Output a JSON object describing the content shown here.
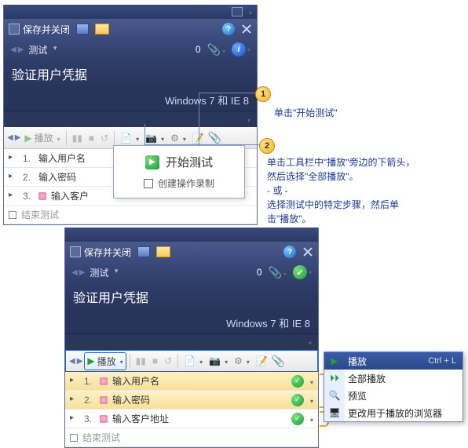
{
  "panel1": {
    "save_close": "保存并关闭",
    "tab": "测试",
    "count": "0",
    "title": "验证用户凭据",
    "env": "Windows 7 和 IE 8",
    "play_label": "播放",
    "steps": {
      "s1": "输入用户名",
      "s2": "输入密码",
      "s3": "输入客户",
      "end": "结束测试"
    }
  },
  "popup": {
    "title": "开始测试",
    "chk": "创建操作录制"
  },
  "callouts": {
    "c1": "单击\"开始测试\"",
    "c2a": "单击工具栏中\"播放\"旁边的下箭头，然后选择\"全部播放\"。",
    "c2or": "- 或 -",
    "c2b": "选择测试中的特定步骤，然后单击\"播放\"。"
  },
  "panel2": {
    "save_close": "保存并关闭",
    "tab": "测试",
    "count": "0",
    "title": "验证用户凭据",
    "env": "Windows 7 和 IE 8",
    "play_label": "播放",
    "steps": {
      "s1": "输入用户名",
      "s2": "输入密码",
      "s3": "输入客户地址",
      "end": "结束测试"
    }
  },
  "menu": {
    "play": "播放",
    "play_sc": "Ctrl + L",
    "play_all": "全部播放",
    "preview": "预览",
    "change": "更改用于播放的浏览器"
  }
}
